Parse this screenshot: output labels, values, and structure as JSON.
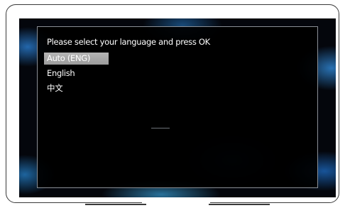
{
  "language_dialog": {
    "title": "Please select your language and press OK",
    "options": [
      {
        "label": "Auto (ENG)",
        "selected": true
      },
      {
        "label": "English",
        "selected": false
      },
      {
        "label": "中文",
        "selected": false
      }
    ]
  },
  "colors": {
    "dialog_background": "#000000",
    "highlight": "#a8a8a8",
    "text": "#ffffff",
    "screen_glow": "#2f8fd8"
  }
}
